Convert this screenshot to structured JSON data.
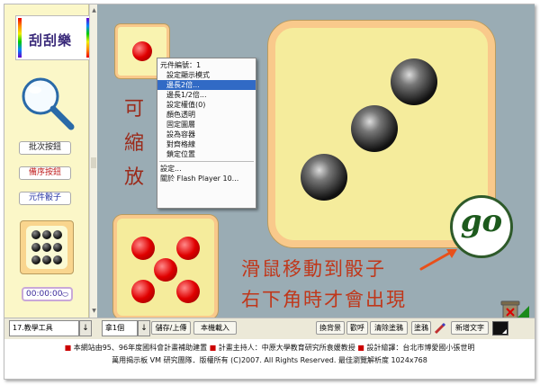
{
  "sidebar": {
    "logo_text": "刮刮樂",
    "buttons": {
      "batch": "批次按鈕",
      "hide": "備序按鈕",
      "dice": "元件骰子"
    },
    "timer": "00:00:00"
  },
  "canvas": {
    "vertical_text": [
      "可",
      "縮",
      "放"
    ],
    "caption_line1": "滑鼠移動到骰子",
    "caption_line2": "右下角時才會出現",
    "go_label": "go"
  },
  "context_menu": {
    "items": [
      "元件編號：1",
      "設定顯示模式",
      "邊長2倍...",
      "邊長1/2倍...",
      "設定權值(0)",
      "顏色透明",
      "固定圖層",
      "設為容器",
      "對齊格線",
      "鎖定位置",
      "設定...",
      "關於 Flash Player 10..."
    ],
    "highlighted_index": 2
  },
  "toolbar": {
    "tool_select": "17.教學工具",
    "tool_arrow": "↓",
    "page_select": "拿1個",
    "page_arrow": "↓",
    "save_upload": "儲存/上傳",
    "load_file": "本機載入",
    "change_bg": "換背景",
    "smile": "歡呼",
    "clear_paint": "清除塗鴉",
    "paint": "塗鴉",
    "add_text": "新增文字"
  },
  "footer": {
    "line1_a": "本網站由95、96年度國科會計畫補助建置",
    "line1_b": "計畫主持人：中原大學教育研究所袁媛教授",
    "line1_c": "設計繪譯：台北市博愛國小張世明",
    "line2": "萬用揭示板 VM 研究團隊．版權所有 (C)2007. All Rights Reserved. 最佳瀏覽解析度 1024x768"
  },
  "colors": {
    "canvas_bg": "#9aacb4",
    "die_face": "#f5ec9c",
    "die_border": "#f9c98b",
    "caption": "#c0371a",
    "menu_highlight": "#316ac5"
  }
}
